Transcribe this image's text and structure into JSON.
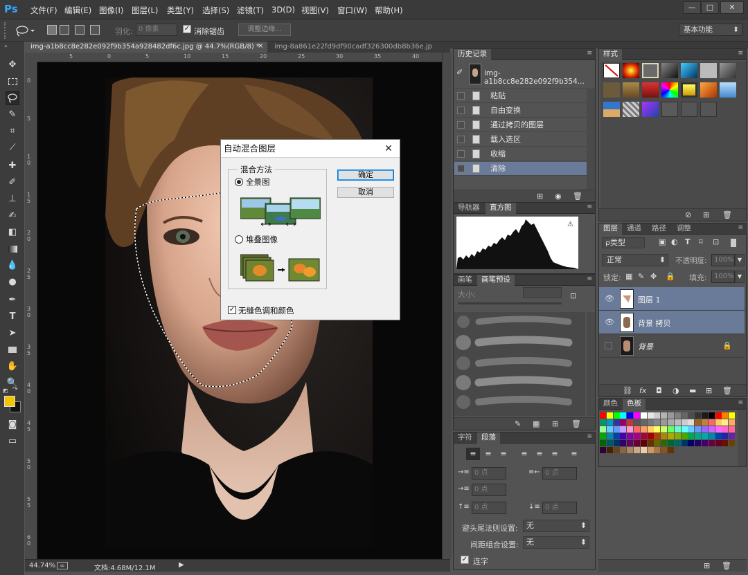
{
  "app": {
    "logo": "Ps",
    "menu": [
      "文件(F)",
      "编辑(E)",
      "图像(I)",
      "图层(L)",
      "类型(Y)",
      "选择(S)",
      "滤镜(T)",
      "3D(D)",
      "视图(V)",
      "窗口(W)",
      "帮助(H)"
    ],
    "window_controls": [
      "—",
      "□",
      "✕"
    ]
  },
  "options_bar": {
    "feather_label": "羽化:",
    "feather_value": "0 像素",
    "antialias_label": "消除锯齿",
    "refine_edge_label": "调整边缘...",
    "workspace": "基本功能"
  },
  "tabs": [
    {
      "label": "img-a1b8cc8e282e092f9b354a928482df6c.jpg @ 44.7%(RGB/8) *",
      "close": "×"
    },
    {
      "label": "img-8a861e22fd9df90cadf326300db8b36e.jp"
    }
  ],
  "ruler": {
    "h_ticks": [
      "5",
      "0",
      "5",
      "10",
      "15",
      "20",
      "25",
      "30",
      "35",
      "40"
    ],
    "v_ticks": [
      "0",
      "5",
      "1 0",
      "1 5",
      "2 0",
      "2 5",
      "3 0",
      "3 5",
      "4 0",
      "4 5",
      "5 0",
      "5 5",
      "6 0"
    ]
  },
  "status": {
    "zoom": "44.74%",
    "doc": "文档:4.68M/12.1M"
  },
  "history": {
    "tab": "历史记录",
    "snapshot": "img-a1b8cc8e282e092f9b354...",
    "items": [
      "粘贴",
      "自由变换",
      "通过拷贝的图层",
      "载入选区",
      "收缩",
      "清除"
    ]
  },
  "navigator": {
    "tabs": [
      "导航器",
      "直方图"
    ]
  },
  "brush": {
    "tabs": [
      "画笔",
      "画笔预设"
    ],
    "size_label": "大小:"
  },
  "char": {
    "tabs": [
      "字符",
      "段落"
    ],
    "indent_fields": [
      "0 点",
      "0 点",
      "0 点",
      "0 点",
      "0 点"
    ],
    "hyphen_label": "避头尾法则设置:",
    "hyphen_value": "无",
    "spacing_label": "间距组合设置:",
    "spacing_value": "无",
    "lianzi_label": "连字"
  },
  "styles": {
    "tab": "样式"
  },
  "layers": {
    "tabs": [
      "图层",
      "通道",
      "路径",
      "调整"
    ],
    "filter_label": "ρ类型",
    "blend_mode": "正常",
    "opacity_label": "不透明度:",
    "opacity_value": "100%",
    "lock_label": "锁定:",
    "fill_label": "填充:",
    "fill_value": "100%",
    "items": [
      {
        "name": "图层 1"
      },
      {
        "name": "背景 拷贝"
      },
      {
        "name": "背景"
      }
    ]
  },
  "colorpanel": {
    "tabs": [
      "颜色",
      "色板"
    ]
  },
  "dialog": {
    "title": "自动混合图层",
    "group_label": "混合方法",
    "option1": "全景图",
    "option2": "堆叠图像",
    "checkbox_label": "无缝色调和颜色",
    "ok": "确定",
    "cancel": "取消",
    "close": "✕"
  },
  "colors": {
    "foreground": "#f5c400",
    "background": "#111111",
    "accent": "#31a8ff"
  }
}
